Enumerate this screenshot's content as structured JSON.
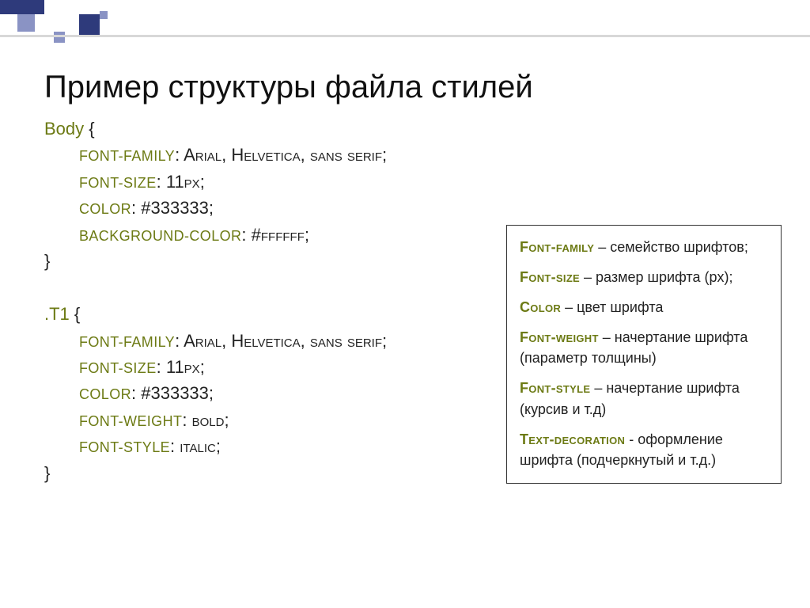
{
  "title": "Пример структуры файла стилей",
  "code": {
    "block1": {
      "selector": "Body",
      "lines": [
        {
          "prop": "font-family",
          "val": "Arial, Helvetica, sans serif;"
        },
        {
          "prop": "font-size",
          "val": "11px;"
        },
        {
          "prop": "color",
          "val": "  #333333;"
        },
        {
          "prop": "background-color",
          "val": "  #ffffff;"
        }
      ]
    },
    "block2": {
      "selector": ".T1",
      "lines": [
        {
          "prop": "font-family",
          "val": "Arial, Helvetica, sans serif;"
        },
        {
          "prop": "font-size",
          "val": "11px;"
        },
        {
          "prop": "color",
          "val": "  #333333;"
        },
        {
          "prop": "font-weight",
          "val": "  bold;"
        },
        {
          "prop": "font-style",
          "val": "  italic;"
        }
      ]
    }
  },
  "legend": {
    "items": [
      {
        "term": "Font-family",
        "desc": " – семейство шрифтов;"
      },
      {
        "term": "Font-size",
        "desc": " – размер шрифта (px);"
      },
      {
        "term": "Color",
        "desc": " – цвет шрифта"
      },
      {
        "term": "Font-weight",
        "desc": " – начертание шрифта (параметр толщины)"
      },
      {
        "term": "Font-style",
        "desc": " – начертание шрифта (курсив и т.д)"
      },
      {
        "term": "Text-decoration",
        "desc": "  - оформление шрифта (подчеркнутый и т.д.)"
      }
    ]
  }
}
